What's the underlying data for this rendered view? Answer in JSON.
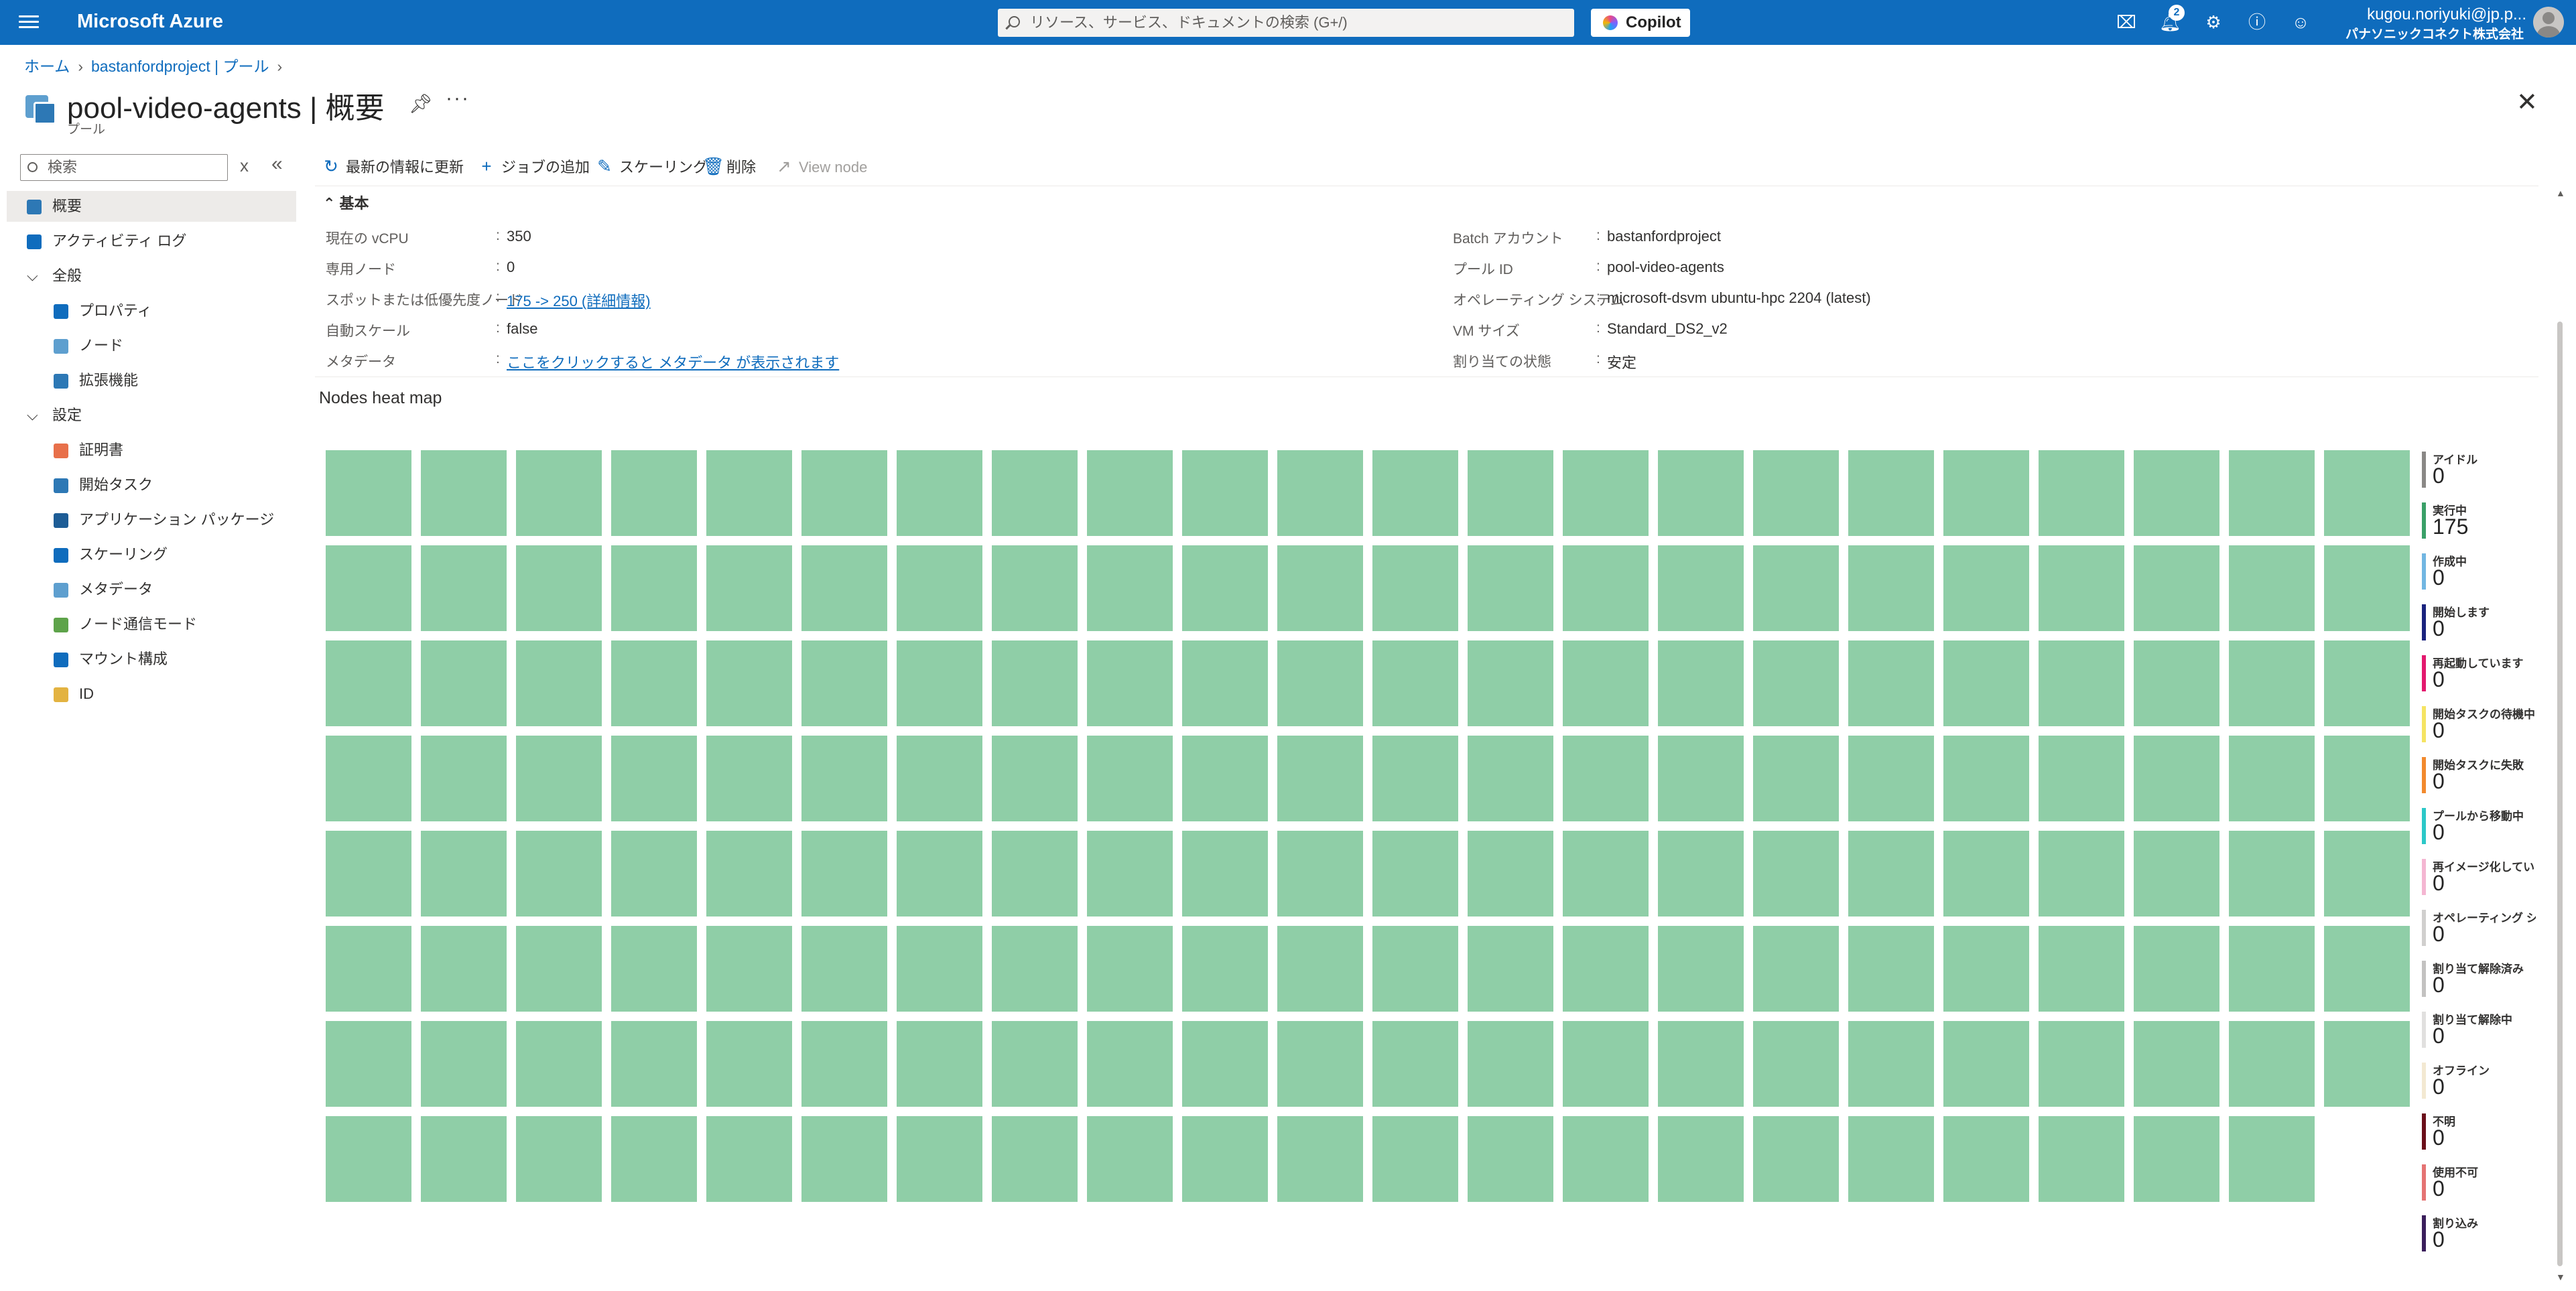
{
  "topbar": {
    "brand": "Microsoft Azure",
    "search_placeholder": "リソース、サービス、ドキュメントの検索 (G+/)",
    "copilot_label": "Copilot",
    "notification_count": "2",
    "user_name": "kugou.noriyuki@jp.p...",
    "user_org": "パナソニックコネクト株式会社 現..."
  },
  "breadcrumb": {
    "home": "ホーム",
    "parent": "bastanfordproject | プール"
  },
  "header": {
    "title": "pool-video-agents | 概要",
    "subtitle": "プール"
  },
  "nav": {
    "search_placeholder": "検索",
    "items": [
      {
        "label": "概要",
        "icon": "pool-icon",
        "color": "#2d78b5"
      },
      {
        "label": "アクティビティ ログ",
        "icon": "activity-log-icon",
        "color": "#0f6cbd"
      },
      {
        "label": "全般",
        "icon": "chevron-down-icon"
      },
      {
        "label": "プロパティ",
        "icon": "properties-icon",
        "color": "#0f6cbd"
      },
      {
        "label": "ノード",
        "icon": "node-icon",
        "color": "#5e9fcf"
      },
      {
        "label": "拡張機能",
        "icon": "extensions-icon",
        "color": "#2d78b5"
      },
      {
        "label": "設定",
        "icon": "chevron-down-icon"
      },
      {
        "label": "証明書",
        "icon": "certificate-icon",
        "color": "#e8704a"
      },
      {
        "label": "開始タスク",
        "icon": "start-task-icon",
        "color": "#2d78b5"
      },
      {
        "label": "アプリケーション パッケージ",
        "icon": "package-icon",
        "color": "#1e5d96"
      },
      {
        "label": "スケーリング",
        "icon": "scaling-icon",
        "color": "#0f6cbd"
      },
      {
        "label": "メタデータ",
        "icon": "metadata-icon",
        "color": "#5e9fcf"
      },
      {
        "label": "ノード通信モード",
        "icon": "communication-mode-icon",
        "color": "#5ea34a"
      },
      {
        "label": "マウント構成",
        "icon": "mount-icon",
        "color": "#0f6cbd"
      },
      {
        "label": "ID",
        "icon": "identity-icon",
        "color": "#e3b341"
      }
    ]
  },
  "toolbar": {
    "refresh": "最新の情報に更新",
    "add_job": "ジョブの追加",
    "scaling": "スケーリング",
    "delete": "削除",
    "view_node": "View node"
  },
  "essentials": {
    "heading": "基本",
    "left": [
      {
        "label": "現在の vCPU",
        "value": "350",
        "link": false
      },
      {
        "label": "専用ノード",
        "value": "0",
        "link": false
      },
      {
        "label": "スポットまたは低優先度ノード",
        "value": "175 -> 250 (詳細情報)",
        "link": true
      },
      {
        "label": "自動スケール",
        "value": "false",
        "link": false
      },
      {
        "label": "メタデータ",
        "value": "ここをクリックすると メタデータ が表示されます",
        "link": true
      }
    ],
    "right": [
      {
        "label": "Batch アカウント",
        "value": "bastanfordproject",
        "link": false
      },
      {
        "label": "プール ID",
        "value": "pool-video-agents",
        "link": false
      },
      {
        "label": "オペレーティング システム",
        "value": "microsoft-dsvm ubuntu-hpc 2204 (latest)",
        "link": false
      },
      {
        "label": "VM サイズ",
        "value": "Standard_DS2_v2",
        "link": false
      },
      {
        "label": "割り当ての状態",
        "value": "安定",
        "link": false
      }
    ]
  },
  "heatmap": {
    "title": "Nodes heat map",
    "node_count": 175,
    "columns": 22,
    "node_color": "#8fcea7"
  },
  "legend": [
    {
      "label": "アイドル",
      "value": "0",
      "color": "#8a8886"
    },
    {
      "label": "実行中",
      "value": "175",
      "color": "#3aa068"
    },
    {
      "label": "作成中",
      "value": "0",
      "color": "#71b6e2"
    },
    {
      "label": "開始します",
      "value": "0",
      "color": "#1a237e"
    },
    {
      "label": "再起動しています",
      "value": "0",
      "color": "#e3196e"
    },
    {
      "label": "開始タスクの待機中",
      "value": "0",
      "color": "#f5e463"
    },
    {
      "label": "開始タスクに失敗",
      "value": "0",
      "color": "#f28a2e"
    },
    {
      "label": "プールから移動中",
      "value": "0",
      "color": "#2cc8c8"
    },
    {
      "label": "再イメージ化しています",
      "value": "0",
      "color": "#f4b6d2"
    },
    {
      "label": "オペレーティング システ",
      "value": "0",
      "color": "#d0cfce"
    },
    {
      "label": "割り当て解除済み",
      "value": "0",
      "color": "#c3c2c1"
    },
    {
      "label": "割り当て解除中",
      "value": "0",
      "color": "#e1e0df"
    },
    {
      "label": "オフライン",
      "value": "0",
      "color": "#f3e9d2"
    },
    {
      "label": "不明",
      "value": "0",
      "color": "#6b0f1a"
    },
    {
      "label": "使用不可",
      "value": "0",
      "color": "#e57373"
    },
    {
      "label": "割り込み",
      "value": "0",
      "color": "#3b1f5c"
    }
  ]
}
